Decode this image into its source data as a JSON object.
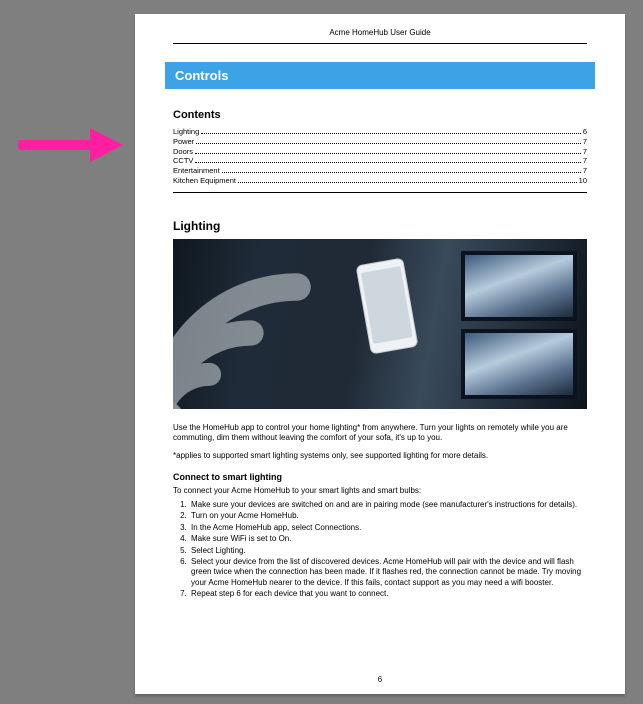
{
  "doc_header": "Acme HomeHub User Guide",
  "banner": "Controls",
  "contents_heading": "Contents",
  "toc": [
    {
      "label": "Lighting",
      "page": "6"
    },
    {
      "label": "Power",
      "page": "7"
    },
    {
      "label": "Doors",
      "page": "7"
    },
    {
      "label": "CCTV",
      "page": "7"
    },
    {
      "label": "Entertainment",
      "page": "7"
    },
    {
      "label": "Kitchen Equipment",
      "page": "10"
    }
  ],
  "lighting_heading": "Lighting",
  "lighting_intro": "Use the HomeHub app to control your home lighting* from anywhere. Turn your lights on remotely while you are commuting, dim them without leaving the comfort of your sofa, it's up to you.",
  "lighting_footnote": "*applies to supported smart lighting systems only, see supported lighting for more details.",
  "connect_heading": "Connect to smart lighting",
  "connect_intro": "To connect your Acme HomeHub to your smart lights and smart bulbs:",
  "steps": [
    "Make sure your devices are switched on and are in pairing mode (see manufacturer's instructions for details).",
    "Turn on your Acme HomeHub.",
    "In the Acme HomeHub app, select Connections.",
    "Make sure WiFi is set to On.",
    "Select Lighting.",
    "Select your device from the list of discovered devices. Acme HomeHub will pair with the device and will flash green twice when the connection has been made. If it flashes red, the connection cannot be made. Try moving your Acme HomeHub nearer to the device. If this fails, contact support as you may need a wifi booster.",
    "Repeat step 6 for each device that you want to connect."
  ],
  "page_number": "6",
  "annotation": {
    "arrow_color": "#ff1fa0"
  }
}
